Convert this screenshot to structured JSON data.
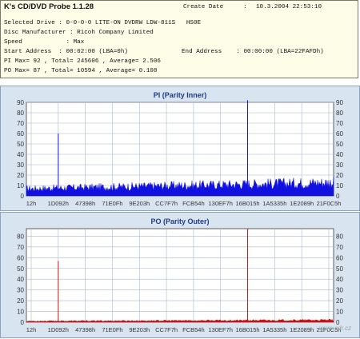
{
  "app": {
    "title": "K's CD/DVD Probe 1.1.28"
  },
  "info": {
    "create_date_label": "Create Date",
    "create_date_sep": ":",
    "create_date_value": "10.3.2004 22:53:10",
    "selected_drive": "Selected Drive : 0-0-0-0 LITE-ON DVDRW LDW-811S   HS0E",
    "disc_manufacturer": "Disc Manufacturer : Ricoh Company Limited",
    "speed": "Speed            : Max",
    "start_address": "Start Address  : 00:02:00 (LBA=0h)",
    "end_address": "End Address    : 00:00:00 (LBA=22FAFDh)",
    "pi_stats": "PI Max= 92 , Total= 245606 , Average= 2.506",
    "po_stats": "PO Max= 87 , Total= 10594 , Average= 0.108"
  },
  "chart_data": [
    {
      "type": "area",
      "title": "PI (Parity Inner)",
      "ylim": [
        0,
        90
      ],
      "yticks": [
        0,
        10,
        20,
        30,
        40,
        50,
        60,
        70,
        80,
        90
      ],
      "x_ticks": [
        "12h",
        "1D092h",
        "47398h",
        "71E0Fh",
        "9E203h",
        "CC7F7h",
        "FCB54h",
        "130EF7h",
        "16B015h",
        "1A5335h",
        "1E2089h",
        "21F0C5h"
      ],
      "series_color": "#1010e0",
      "baseline_level_start": 7,
      "baseline_level_end": 13,
      "spikes": [
        {
          "x": "1D092h",
          "value": 60
        },
        {
          "x": "16B015h",
          "value": 92
        }
      ]
    },
    {
      "type": "area",
      "title": "PO (Parity Outer)",
      "ylim": [
        0,
        87
      ],
      "yticks": [
        0,
        10,
        20,
        30,
        40,
        50,
        60,
        70,
        80
      ],
      "x_ticks": [
        "12h",
        "1D092h",
        "47398h",
        "71E0Fh",
        "9E203h",
        "CC7F7h",
        "FCB54h",
        "130EF7h",
        "16B015h",
        "1A5335h",
        "1E2089h",
        "21F0C5h"
      ],
      "series_color": "#cc1010",
      "baseline_level_start": 1,
      "baseline_level_end": 2,
      "spikes": [
        {
          "x": "1D092h",
          "value": 57
        },
        {
          "x": "16B015h",
          "value": 87
        }
      ]
    }
  ],
  "watermark": "www.cdr.cz"
}
